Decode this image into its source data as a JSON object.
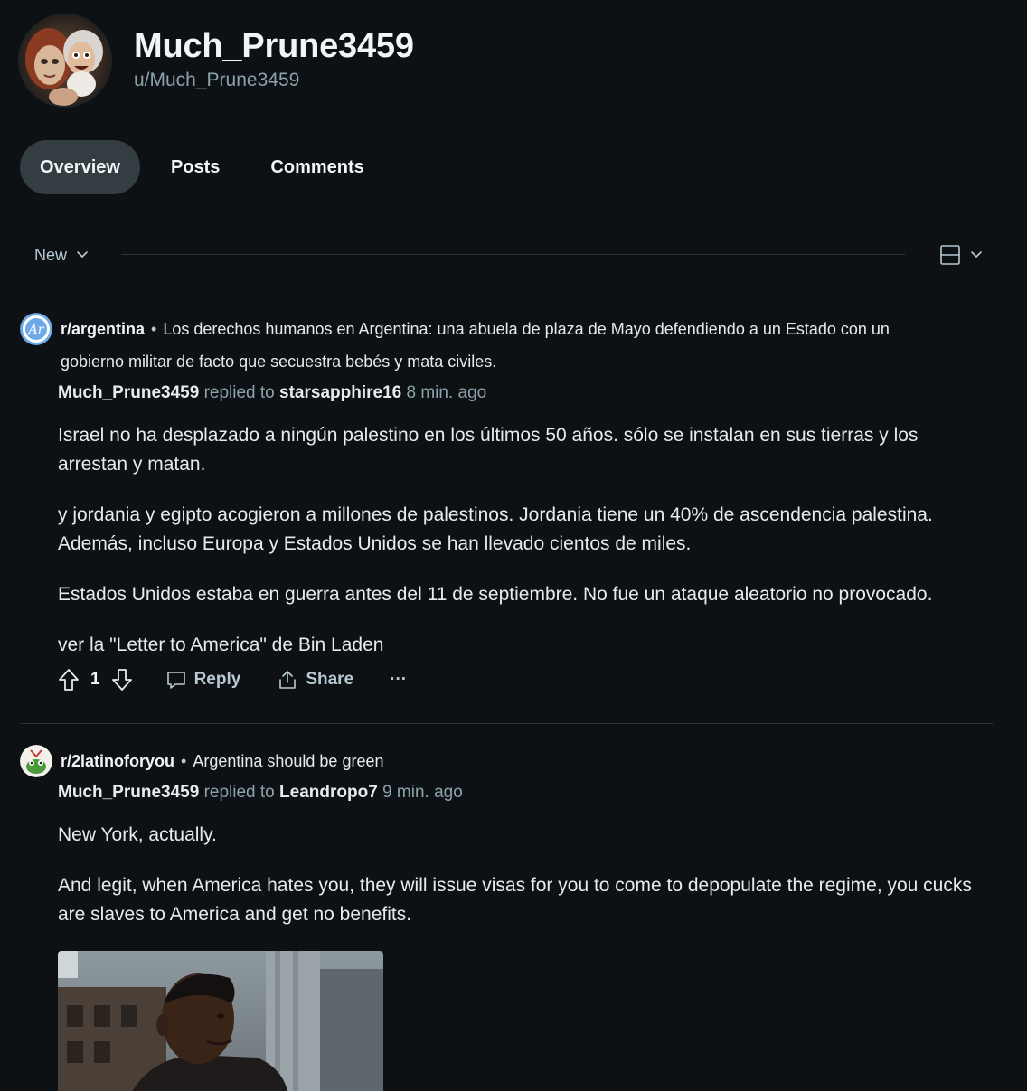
{
  "profile": {
    "display_name": "Much_Prune3459",
    "handle": "u/Much_Prune3459"
  },
  "tabs": [
    {
      "label": "Overview",
      "active": true
    },
    {
      "label": "Posts",
      "active": false
    },
    {
      "label": "Comments",
      "active": false
    }
  ],
  "sort": {
    "label": "New"
  },
  "comments": [
    {
      "subreddit": "r/argentina",
      "post_title": "Los derechos humanos en Argentina: una abuela de plaza de Mayo defendiendo a un Estado con un gobierno militar de facto que secuestra bebés y mata civiles.",
      "author": "Much_Prune3459",
      "replied_to_text": "replied to",
      "replied_to": "starsapphire16",
      "time": "8 min. ago",
      "paragraphs": [
        "Israel no ha desplazado a ningún palestino en los últimos 50 años. sólo se instalan en sus tierras y los arrestan y matan.",
        "y jordania y egipto acogieron a millones de palestinos. Jordania tiene un 40% de ascendencia palestina. Además, incluso Europa y Estados Unidos se han llevado cientos de miles.",
        "Estados Unidos estaba en guerra antes del 11 de septiembre. No fue un ataque aleatorio no provocado.",
        "ver la \"Letter to America\" de Bin Laden"
      ],
      "score": "1",
      "reply_label": "Reply",
      "share_label": "Share",
      "more_label": "···"
    },
    {
      "subreddit": "r/2latinoforyou",
      "post_title": "Argentina should be green",
      "author": "Much_Prune3459",
      "replied_to_text": "replied to",
      "replied_to": "Leandropo7",
      "time": "9 min. ago",
      "paragraphs": [
        "New York, actually.",
        "And legit, when America hates you, they will issue visas for you to come to depopulate the regime, you cucks are slaves to America and get no benefits."
      ]
    }
  ],
  "colors": {
    "background": "#0e1113",
    "active_tab": "#333d42",
    "muted_text": "#8ba2ad"
  }
}
